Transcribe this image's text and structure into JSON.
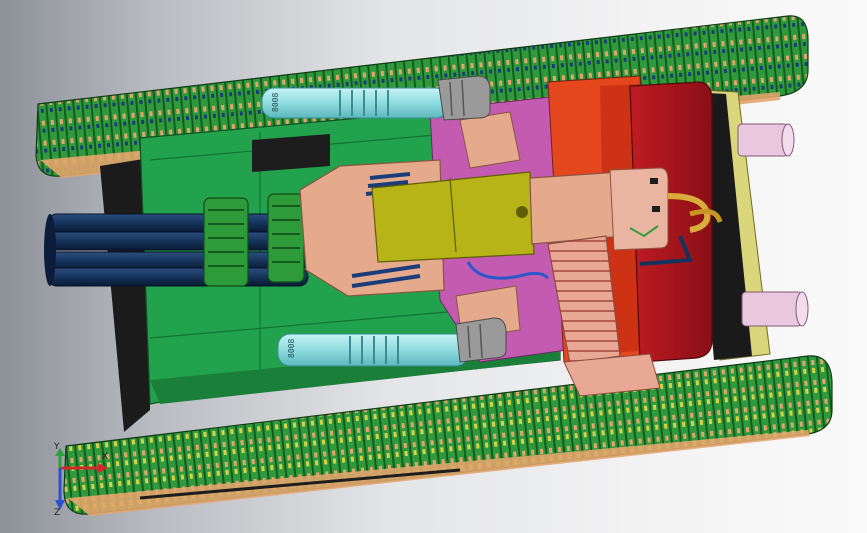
{
  "viewport": {
    "background_left": "#8d9198",
    "background_right": "#fafafa"
  },
  "model": {
    "colors": {
      "track_green": "#2f9a3c",
      "track_dark": "#145a20",
      "track_orange": "#e2a56c",
      "hull_green": "#22a24c",
      "hull_dark": "#137333",
      "hull_black": "#1d1d1d",
      "turret_salmon": "#e5a98c",
      "olive": "#b6b417",
      "barrel_navy": "#15335b",
      "cyan_cylinder": "#8fdcdf",
      "cap_grey": "#9a9a9a",
      "magenta": "#c35bb0",
      "red_orange": "#e4461d",
      "dark_red": "#a5151c",
      "lilac_pipe": "#e8c7df",
      "gold_cable": "#d8ad3a",
      "blue_cable": "#2b58c9"
    },
    "cylinder_labels": [
      "8008",
      "8008"
    ]
  },
  "triad": {
    "axes": [
      {
        "name": "x",
        "label": "X",
        "color": "#d3282a"
      },
      {
        "name": "y",
        "label": "Y",
        "color": "#2f9e3f"
      },
      {
        "name": "z",
        "label": "Z",
        "color": "#2a4fd0"
      }
    ]
  }
}
